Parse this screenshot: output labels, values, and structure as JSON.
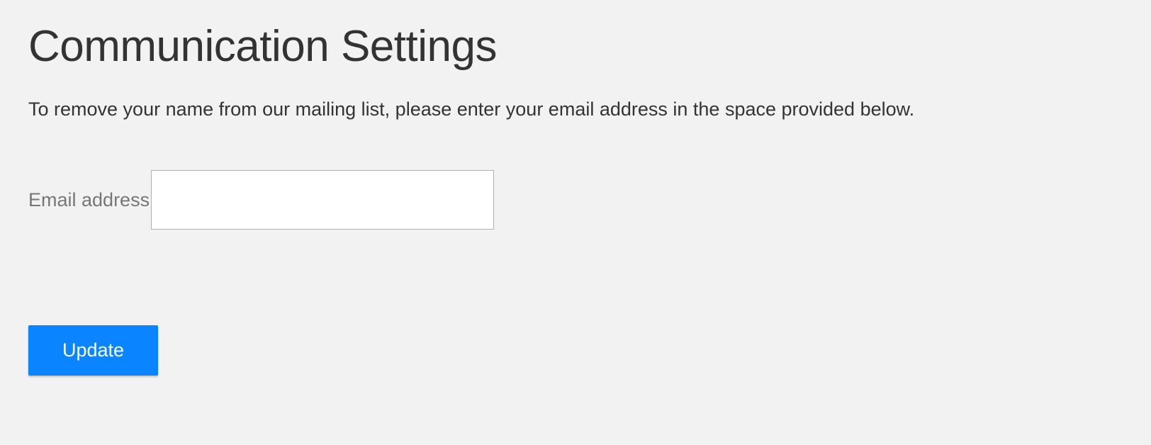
{
  "header": {
    "title": "Communication Settings",
    "description": "To remove your name from our mailing list, please enter your email address in the space provided below."
  },
  "form": {
    "email_label": "Email address",
    "email_value": "",
    "submit_label": "Update"
  }
}
